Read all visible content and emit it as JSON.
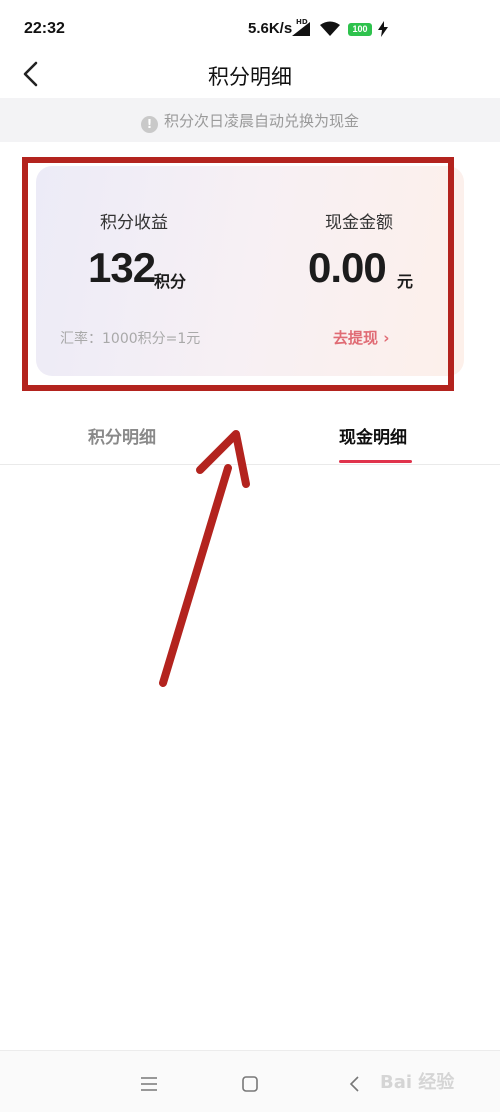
{
  "status": {
    "time": "22:32",
    "speed": "5.6K/s",
    "hd": "HD",
    "battery": "100"
  },
  "header": {
    "title": "积分明细"
  },
  "notice": {
    "text": "积分次日凌晨自动兑换为现金"
  },
  "card": {
    "points_label": "积分收益",
    "points_value": "132",
    "points_unit": "积分",
    "cash_label": "现金金额",
    "cash_value": "0.00",
    "cash_unit": "元",
    "rate": "汇率：1000积分=1元",
    "withdraw": "去提现 ›"
  },
  "tabs": [
    {
      "label": "积分明细",
      "active": false
    },
    {
      "label": "现金明细",
      "active": true
    }
  ],
  "watermark": "Bai 经验",
  "colors": {
    "accent": "#e0334c",
    "annotation": "#b3231e"
  }
}
